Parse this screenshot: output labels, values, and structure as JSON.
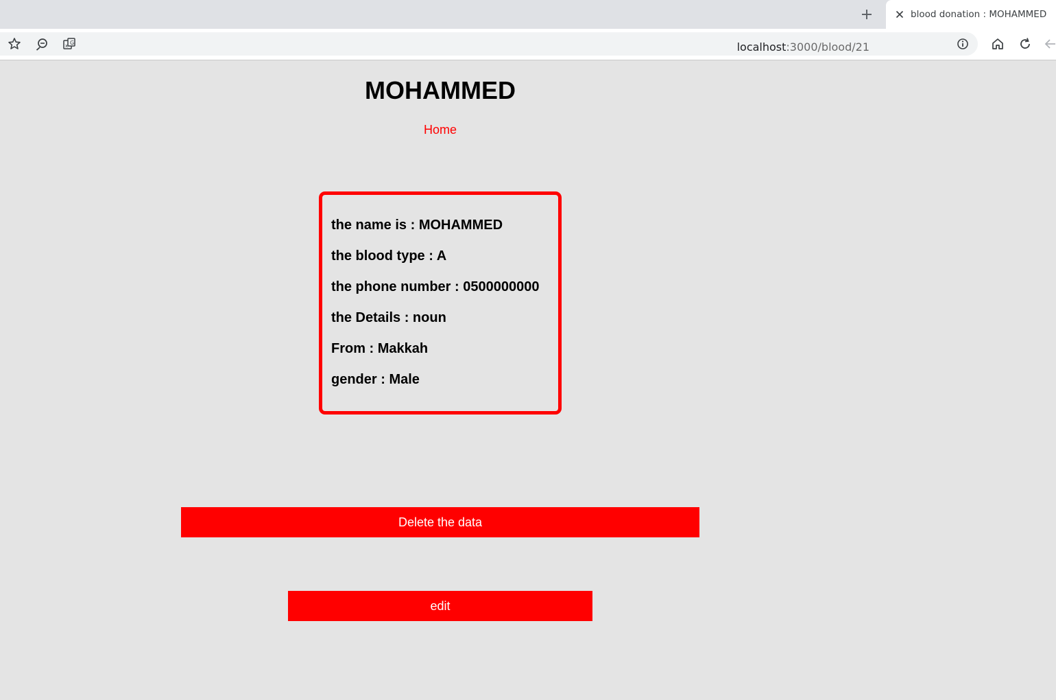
{
  "browser": {
    "tab_title": "blood donation : MOHAMMED",
    "url_host": "localhost",
    "url_path": ":3000/blood/21",
    "icons": [
      "plus-icon",
      "close-icon",
      "star-icon",
      "zoom-out-icon",
      "translate-icon",
      "info-icon",
      "home-icon",
      "reload-icon",
      "back-arrow-icon"
    ]
  },
  "page": {
    "title": "MOHAMMED",
    "home_link": "Home",
    "details": {
      "name": "the name is : MOHAMMED",
      "blood_type": "the blood type : A",
      "phone": "the phone number : 0500000000",
      "details": "the Details : noun",
      "from": "From : Makkah",
      "gender": "gender : Male"
    },
    "delete_button": "Delete the data",
    "edit_button": "edit"
  },
  "colors": {
    "accent": "#ff0000",
    "background": "#e4e4e4",
    "browser_chrome": "#dfe1e5"
  }
}
